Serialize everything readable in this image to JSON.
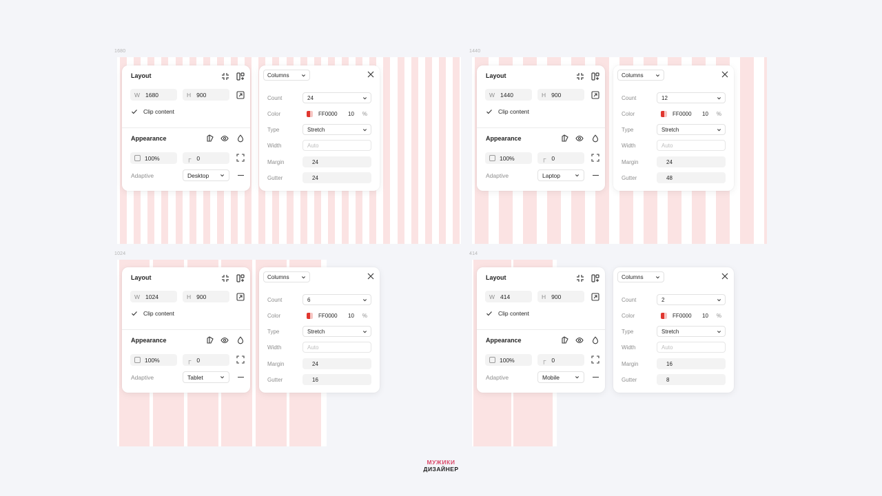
{
  "frames": [
    {
      "size_label": "1680",
      "layout": {
        "title": "Layout",
        "w_prefix": "W",
        "w_value": "1680",
        "h_prefix": "H",
        "h_value": "900",
        "clip_label": "Clip content",
        "appearance_title": "Appearance",
        "opacity": "100%",
        "radius": "0",
        "adaptive_label": "Adaptive",
        "adaptive_value": "Desktop"
      },
      "columns": {
        "dropdown": "Columns",
        "count_label": "Count",
        "count": "24",
        "color_label": "Color",
        "color_hex": "FF0000",
        "color_opacity": "10",
        "color_pct": "%",
        "type_label": "Type",
        "type": "Stretch",
        "width_label": "Width",
        "width_placeholder": "Auto",
        "margin_label": "Margin",
        "margin": "24",
        "gutter_label": "Gutter",
        "gutter": "24"
      }
    },
    {
      "size_label": "1440",
      "layout": {
        "title": "Layout",
        "w_prefix": "W",
        "w_value": "1440",
        "h_prefix": "H",
        "h_value": "900",
        "clip_label": "Clip content",
        "appearance_title": "Appearance",
        "opacity": "100%",
        "radius": "0",
        "adaptive_label": "Adaptive",
        "adaptive_value": "Laptop"
      },
      "columns": {
        "dropdown": "Columns",
        "count_label": "Count",
        "count": "12",
        "color_label": "Color",
        "color_hex": "FF0000",
        "color_opacity": "10",
        "color_pct": "%",
        "type_label": "Type",
        "type": "Stretch",
        "width_label": "Width",
        "width_placeholder": "Auto",
        "margin_label": "Margin",
        "margin": "24",
        "gutter_label": "Gutter",
        "gutter": "48"
      }
    },
    {
      "size_label": "1024",
      "layout": {
        "title": "Layout",
        "w_prefix": "W",
        "w_value": "1024",
        "h_prefix": "H",
        "h_value": "900",
        "clip_label": "Clip content",
        "appearance_title": "Appearance",
        "opacity": "100%",
        "radius": "0",
        "adaptive_label": "Adaptive",
        "adaptive_value": "Tablet"
      },
      "columns": {
        "dropdown": "Columns",
        "count_label": "Count",
        "count": "6",
        "color_label": "Color",
        "color_hex": "FF0000",
        "color_opacity": "10",
        "color_pct": "%",
        "type_label": "Type",
        "type": "Stretch",
        "width_label": "Width",
        "width_placeholder": "Auto",
        "margin_label": "Margin",
        "margin": "24",
        "gutter_label": "Gutter",
        "gutter": "16"
      }
    },
    {
      "size_label": "414",
      "layout": {
        "title": "Layout",
        "w_prefix": "W",
        "w_value": "414",
        "h_prefix": "H",
        "h_value": "900",
        "clip_label": "Clip content",
        "appearance_title": "Appearance",
        "opacity": "100%",
        "radius": "0",
        "adaptive_label": "Adaptive",
        "adaptive_value": "Mobile"
      },
      "columns": {
        "dropdown": "Columns",
        "count_label": "Count",
        "count": "2",
        "color_label": "Color",
        "color_hex": "FF0000",
        "color_opacity": "10",
        "color_pct": "%",
        "type_label": "Type",
        "type": "Stretch",
        "width_label": "Width",
        "width_placeholder": "Auto",
        "margin_label": "Margin",
        "margin": "16",
        "gutter_label": "Gutter",
        "gutter": "8"
      }
    }
  ],
  "colors": {
    "grid_column": "#fbe3e3",
    "swatch": "#e0362f",
    "background": "#f4f5f9",
    "logo_accent": "#d94a6a"
  },
  "logo": {
    "line1": "МУЖИКИ",
    "line2": "ДИЗАЙНЕР"
  }
}
